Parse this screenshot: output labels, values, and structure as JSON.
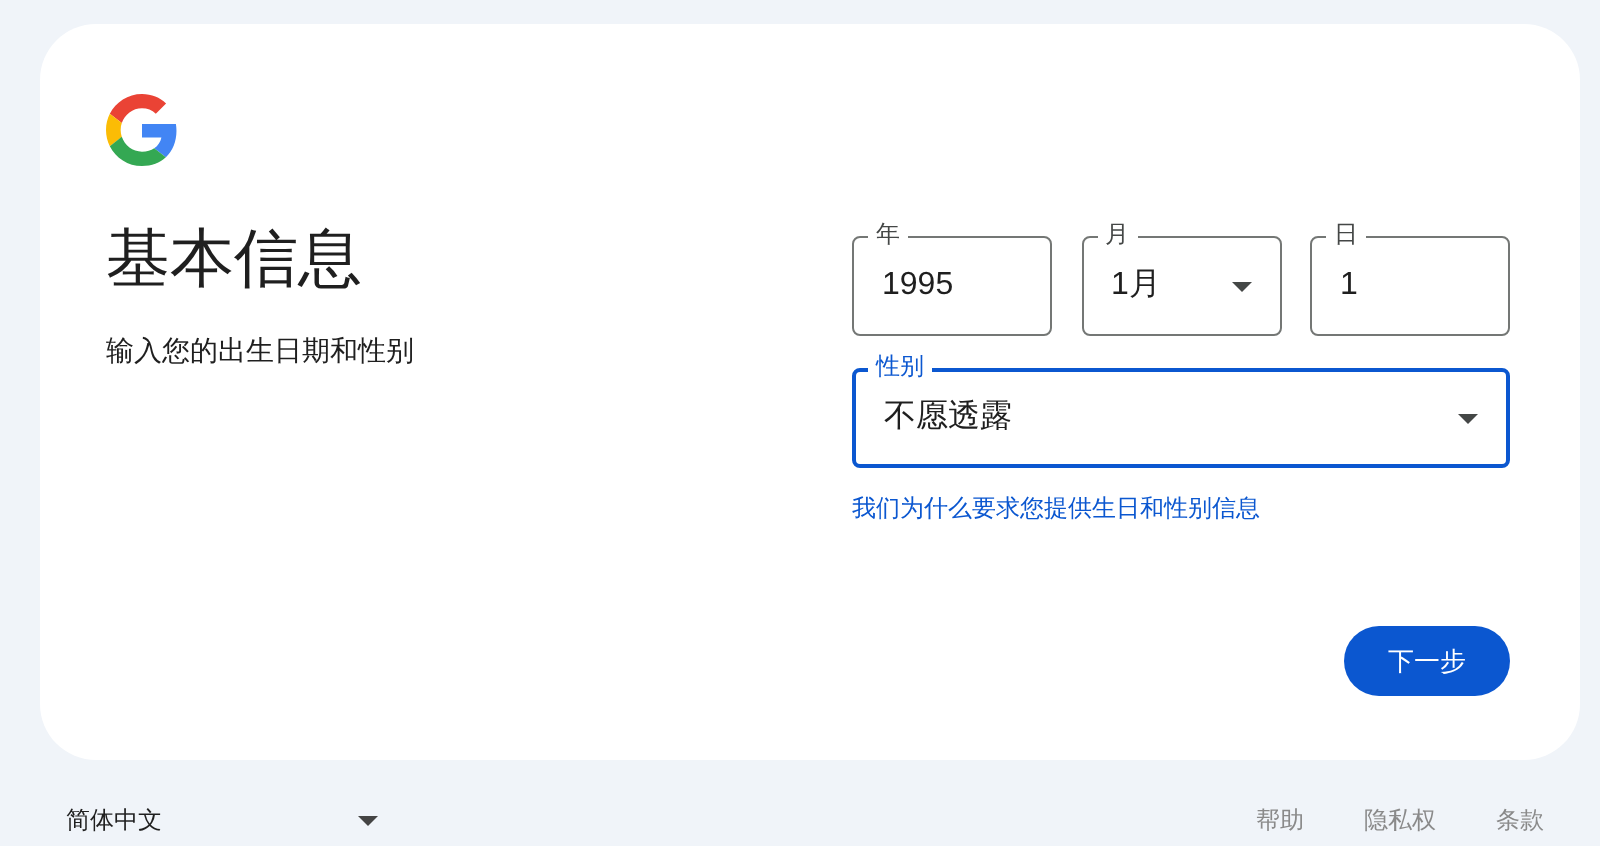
{
  "title": "基本信息",
  "subtitle": "输入您的出生日期和性别",
  "date_fields": [
    {
      "kind": "text",
      "label": "年",
      "value": "1995",
      "focused": false
    },
    {
      "kind": "select",
      "label": "月",
      "value": "1月",
      "focused": false
    },
    {
      "kind": "text",
      "label": "日",
      "value": "1",
      "focused": false
    }
  ],
  "gender_field": {
    "kind": "select",
    "label": "性别",
    "value": "不愿透露",
    "focused": true
  },
  "help_link": "我们为什么要求您提供生日和性别信息",
  "next_button": "下一步",
  "footer": {
    "language": "简体中文",
    "links": [
      "帮助",
      "隐私权",
      "条款"
    ]
  }
}
